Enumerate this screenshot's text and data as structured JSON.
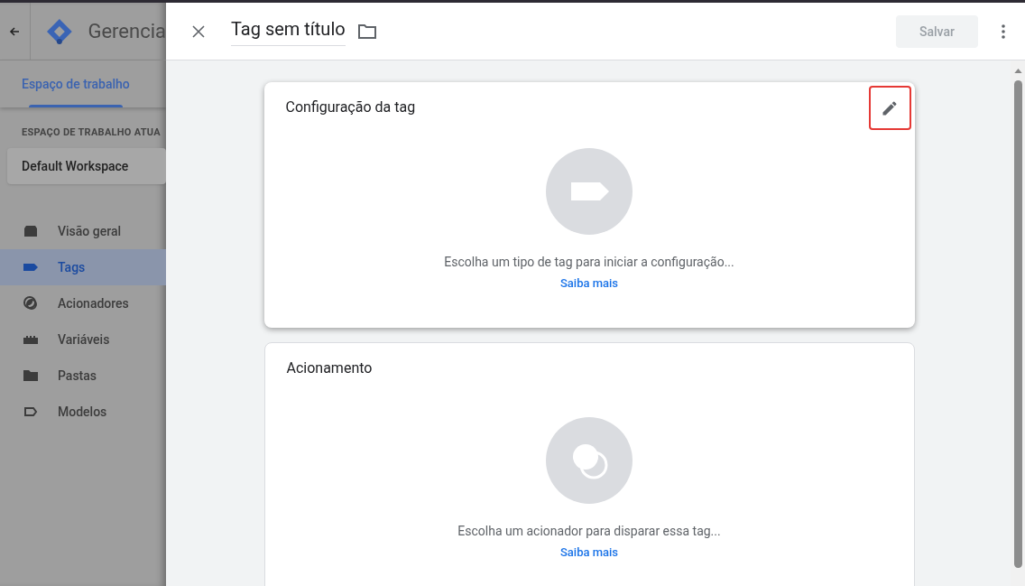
{
  "app": {
    "title": "Gerencia",
    "tabs": [
      {
        "label": "Espaço de trabalho",
        "selected": true
      }
    ],
    "workspace_label": "ESPAÇO DE TRABALHO ATUA",
    "workspace": "Default Workspace",
    "nav": [
      {
        "label": "Visão geral",
        "kind": "overview",
        "selected": false
      },
      {
        "label": "Tags",
        "kind": "tag",
        "selected": true
      },
      {
        "label": "Acionadores",
        "kind": "trigger",
        "selected": false
      },
      {
        "label": "Variáveis",
        "kind": "variable",
        "selected": false
      },
      {
        "label": "Pastas",
        "kind": "folder",
        "selected": false
      },
      {
        "label": "Modelos",
        "kind": "template",
        "selected": false
      }
    ]
  },
  "panel": {
    "title": "Tag sem título",
    "save": {
      "label": "Salvar",
      "disabled": true
    },
    "cards": [
      {
        "kind": "tag",
        "title": "Configuração da tag",
        "hint": "Escolha um tipo de tag para iniciar a configuração...",
        "link": "Saiba mais",
        "edit_highlighted": true
      },
      {
        "kind": "trigger",
        "title": "Acionamento",
        "hint": "Escolha um acionador para disparar essa tag...",
        "link": "Saiba mais"
      }
    ]
  }
}
